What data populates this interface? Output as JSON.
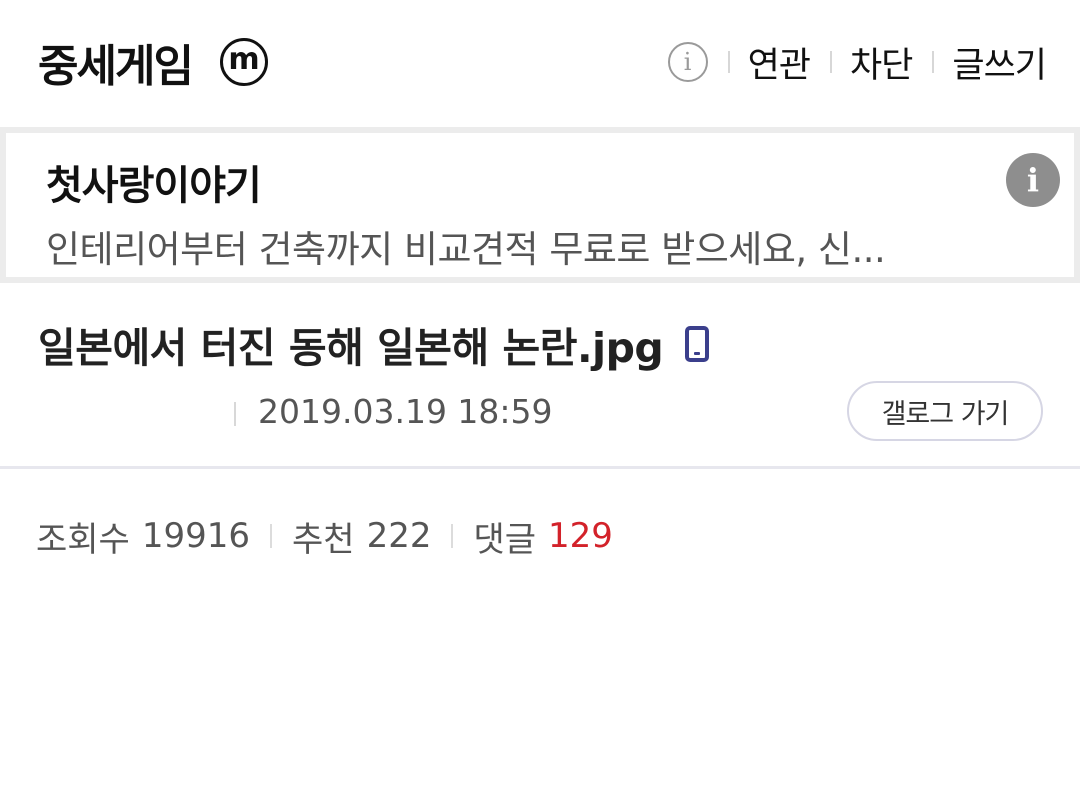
{
  "header": {
    "gallery_title": "중세게임",
    "gallery_badge": "m",
    "info_glyph": "i",
    "menu": {
      "related": "연관",
      "block": "차단",
      "write": "글쓰기"
    }
  },
  "ad": {
    "title": "첫사랑이야기",
    "description": "인테리어부터 건축까지 비교견적 무료로 받으세요, 신...",
    "info_glyph": "i"
  },
  "post": {
    "title": "일본에서 터진 동해 일본해 논란.jpg",
    "device_icon": "mobile-phone-icon",
    "date": "2019.03.19 18:59",
    "gallog_button": "갤로그 가기"
  },
  "stats": {
    "views_label": "조회수",
    "views": "19916",
    "recommend_label": "추천",
    "recommend": "222",
    "comments_label": "댓글",
    "comments": "129",
    "comments_color": "#d3222a"
  },
  "colors": {
    "mobile_icon": "#3b3f8c",
    "ad_border": "#ececec"
  }
}
